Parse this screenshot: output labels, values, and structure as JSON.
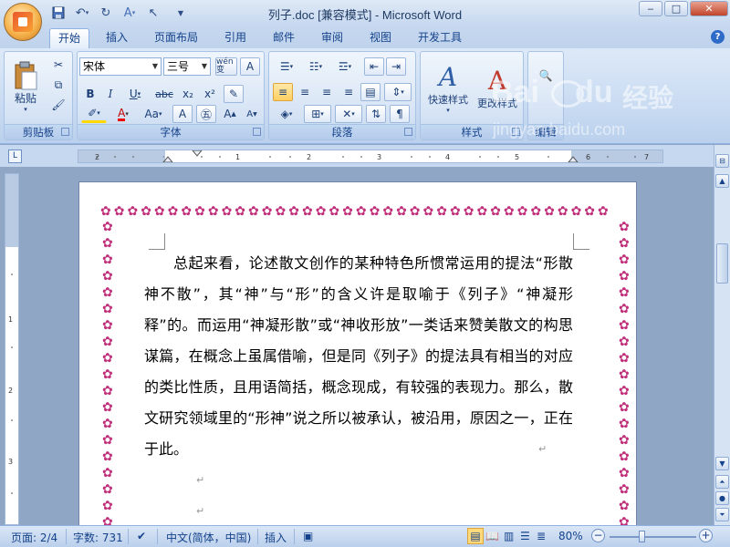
{
  "window": {
    "title": "列子.doc [兼容模式] - Microsoft Word",
    "minimize": "‒",
    "maximize": "□",
    "close": "✕"
  },
  "quick_access": {
    "save_icon": "save-icon",
    "undo_icon": "undo-icon",
    "redo_icon": "redo-icon",
    "customize": "▼"
  },
  "tabs": [
    "开始",
    "插入",
    "页面布局",
    "引用",
    "邮件",
    "审阅",
    "视图",
    "开发工具"
  ],
  "active_tab": "开始",
  "help": "?",
  "ribbon": {
    "clipboard": {
      "label": "剪贴板",
      "paste": "粘贴"
    },
    "font": {
      "label": "字体",
      "font_name": "宋体",
      "font_size": "三号",
      "bold": "B",
      "italic": "I",
      "underline": "U",
      "strike": "abc",
      "subscript": "x₂",
      "superscript": "x²",
      "grow": "A",
      "shrink": "A",
      "wen": "wén 变",
      "char_border": "A",
      "font_color": "A",
      "case": "Aa"
    },
    "paragraph": {
      "label": "段落"
    },
    "styles": {
      "label": "样式",
      "quick_styles": "快速样式",
      "change_styles": "更改样式"
    },
    "editing": {
      "label": "编辑"
    }
  },
  "document": {
    "body": "总起来看，论述散文创作的某种特色所惯常运用的提法“形散神不散”，其“神”与“形”的含义许是取喻于《列子》“神凝形释”的。而运用“神凝形散”或“神收形放”一类话来赞美散文的构思谋篇，在概念上虽属借喻，但是同《列子》的提法具有相当的对应的类比性质，且用语简括，概念现成，有较强的表现力。那么，散文研究领域里的“形神”说之所以被承认，被沿用，原因之一，正在于此。",
    "paragraph_mark": "↵"
  },
  "watermark": {
    "brand": "Bai",
    "du": "du",
    "jingyan": "经验",
    "url": "jingyan.baidu.com"
  },
  "status": {
    "page": "页面: 2/4",
    "words": "字数: 731",
    "language": "中文(简体，中国)",
    "mode": "插入",
    "zoom": "80%",
    "zoom_out": "−",
    "zoom_in": "+"
  }
}
